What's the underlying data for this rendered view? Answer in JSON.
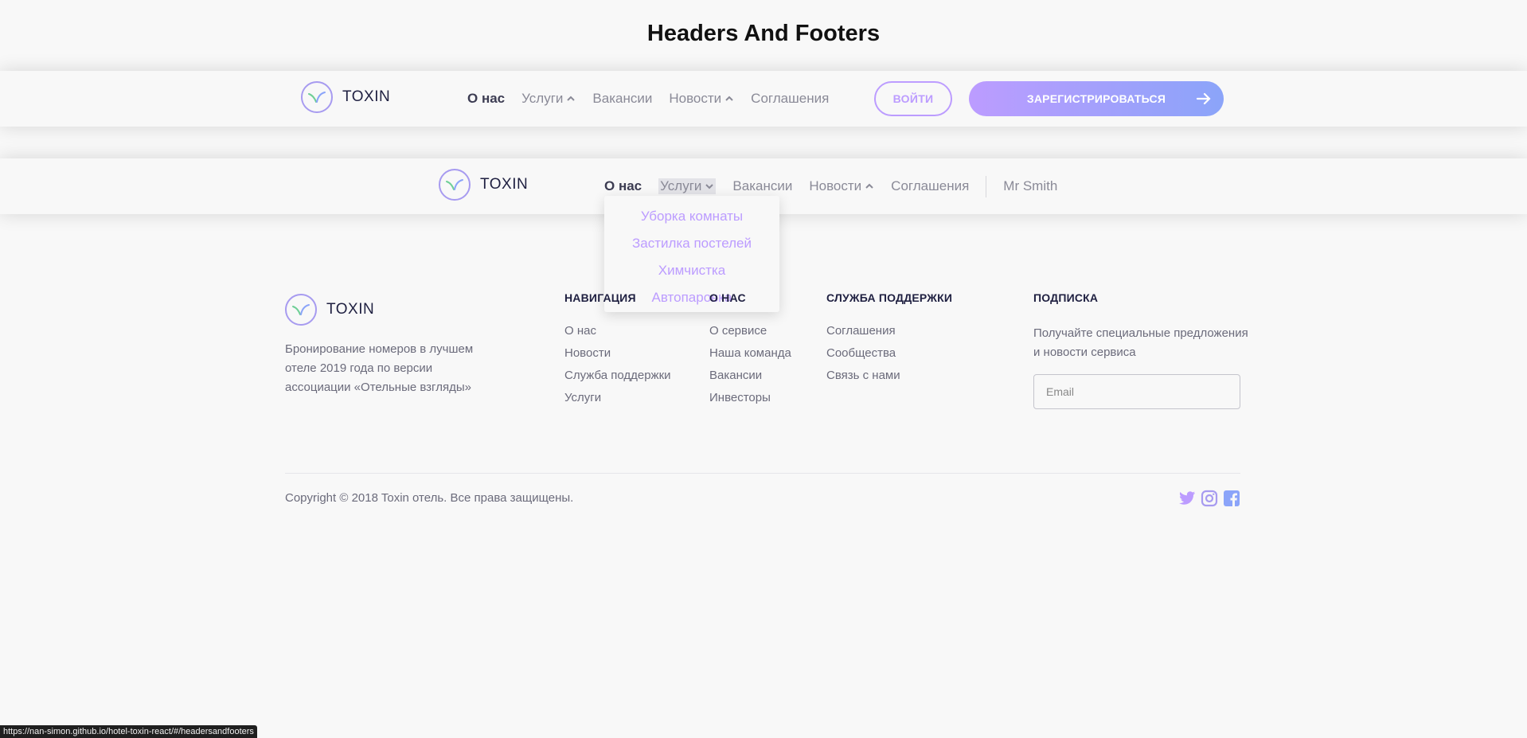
{
  "page": {
    "title": "Headers And Footers"
  },
  "brand": {
    "name": "TOXIN"
  },
  "header1": {
    "nav": [
      {
        "label": "О нас",
        "active": true,
        "chevron": ""
      },
      {
        "label": "Услуги",
        "active": false,
        "chevron": "up"
      },
      {
        "label": "Вакансии",
        "active": false,
        "chevron": ""
      },
      {
        "label": "Новости",
        "active": false,
        "chevron": "up"
      },
      {
        "label": "Соглашения",
        "active": false,
        "chevron": ""
      }
    ],
    "login_label": "ВОЙТИ",
    "register_label": "ЗАРЕГИСТРИРОВАТЬСЯ"
  },
  "header2": {
    "nav": [
      {
        "label": "О нас",
        "active": true,
        "chevron": ""
      },
      {
        "label": "Услуги",
        "active": false,
        "chevron": "down",
        "highlighted": true
      },
      {
        "label": "Вакансии",
        "active": false,
        "chevron": ""
      },
      {
        "label": "Новости",
        "active": false,
        "chevron": "up"
      },
      {
        "label": "Соглашения",
        "active": false,
        "chevron": ""
      }
    ],
    "user_name": "Mr Smith",
    "dropdown": [
      "Уборка комнаты",
      "Застилка постелей",
      "Химчистка",
      "Автопаровка"
    ]
  },
  "footer": {
    "about": "Бронирование номеров в лучшем отеле 2019 года по версии ассоциации «Отельные взгляды»",
    "columns": [
      {
        "title": "НАВИГАЦИЯ",
        "items": [
          "О нас",
          "Новости",
          "Служба поддержки",
          "Услуги"
        ]
      },
      {
        "title": "О НАС",
        "items": [
          "О сервисе",
          "Наша команда",
          "Вакансии",
          "Инвесторы"
        ]
      },
      {
        "title": "СЛУЖБА ПОДДЕРЖКИ",
        "items": [
          "Соглашения",
          "Сообщества",
          "Связь с нами"
        ]
      }
    ],
    "subscribe": {
      "title": "ПОДПИСКА",
      "text": "Получайте специальные предложения и новости сервиса",
      "placeholder": "Email"
    },
    "copyright": "Copyright © 2018 Toxin отель. Все права защищены.",
    "social": [
      "twitter-icon",
      "instagram-icon",
      "facebook-icon"
    ]
  },
  "status_bar": {
    "url": "https://nan-simon.github.io/hotel-toxin-react/#/headersandfooters"
  },
  "colors": {
    "accent": "#bc9cff",
    "accent_2": "#8ba4f9",
    "text_dark": "#1f2041",
    "text_muted": "#8a8a97"
  }
}
